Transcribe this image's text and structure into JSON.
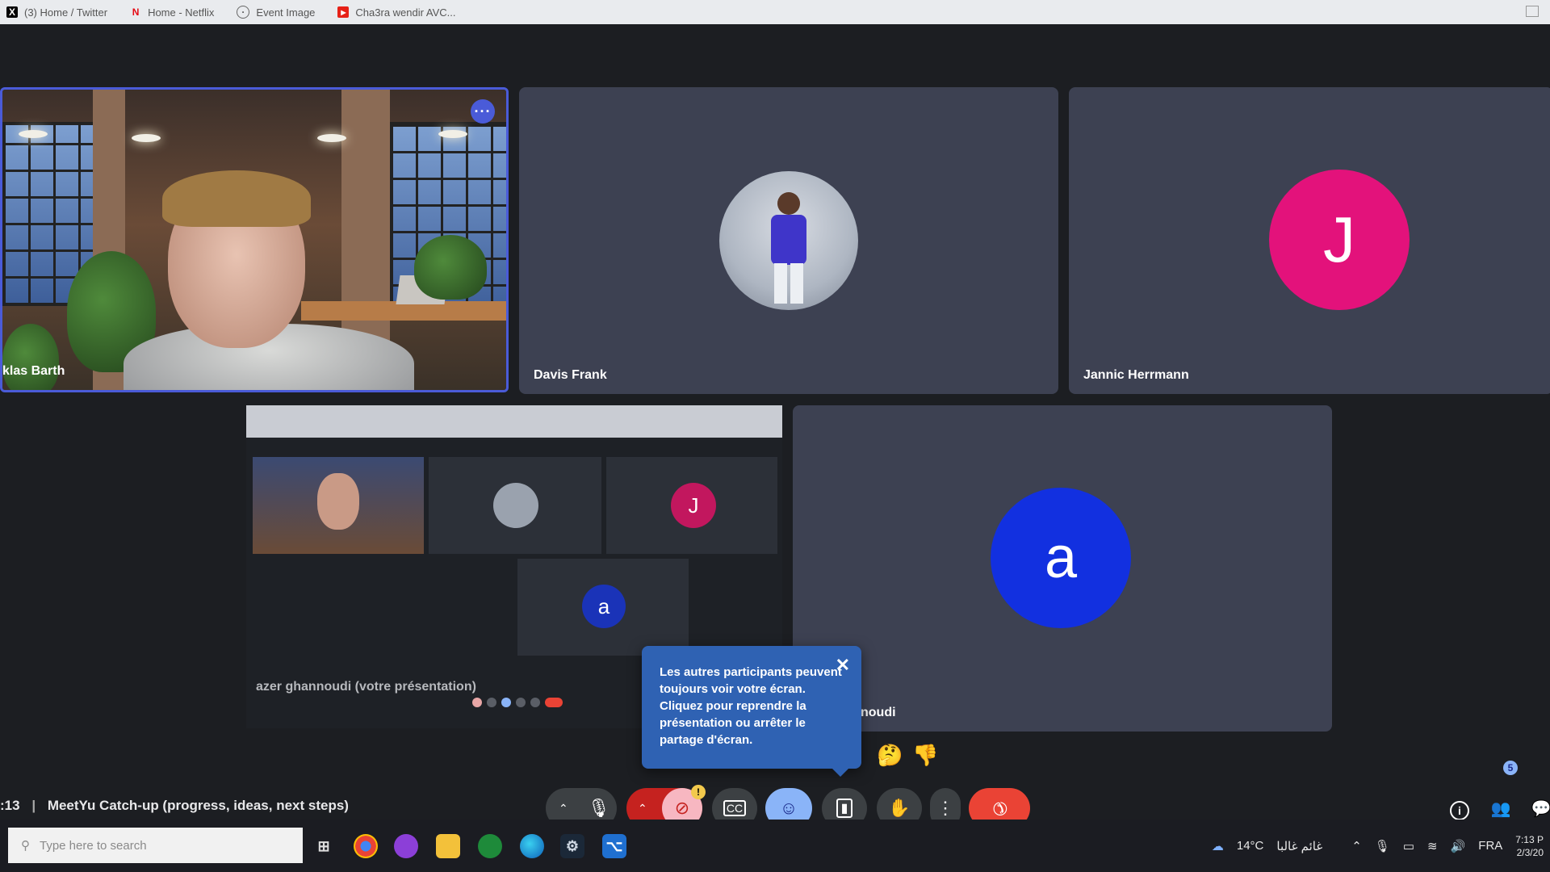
{
  "bookmarks": [
    {
      "label": "(3) Home / Twitter",
      "icon": "x-icon"
    },
    {
      "label": "Home - Netflix",
      "icon": "netflix-icon"
    },
    {
      "label": "Event Image",
      "icon": "globe-icon"
    },
    {
      "label": "Cha3ra wendir AVC...",
      "icon": "youtube-icon"
    }
  ],
  "tiles": {
    "self": {
      "name": "klas Barth"
    },
    "davis": {
      "name": "Davis Frank"
    },
    "jannic": {
      "name": "Jannic Herrmann",
      "initial": "J",
      "color": "#e3127b"
    },
    "presenter": {
      "name": "noudi",
      "initial": "a",
      "color": "#1230e0"
    }
  },
  "share": {
    "caption": "azer ghannoudi (votre présentation)",
    "mini_initial_j": "J",
    "mini_initial_a": "a"
  },
  "tooltip": {
    "text": "Les autres participants peuvent toujours voir votre écran. Cliquez pour reprendre la présentation ou arrêter le partage d'écran."
  },
  "meeting": {
    "time": ":13",
    "separator": "|",
    "title": "MeetYu Catch-up (progress, ideas, next steps)"
  },
  "controls": {
    "camera_badge": "!",
    "people_count": "5"
  },
  "taskbar": {
    "search_placeholder": "Type here to search",
    "weather": "14°C",
    "weather_label": "غائم غالبا",
    "language": "FRA",
    "time": "7:13 P",
    "date": "2/3/20"
  },
  "colors": {
    "accent_blue": "#4a5bd8",
    "end_call": "#ea4335",
    "active_control": "#8ab4f8"
  }
}
